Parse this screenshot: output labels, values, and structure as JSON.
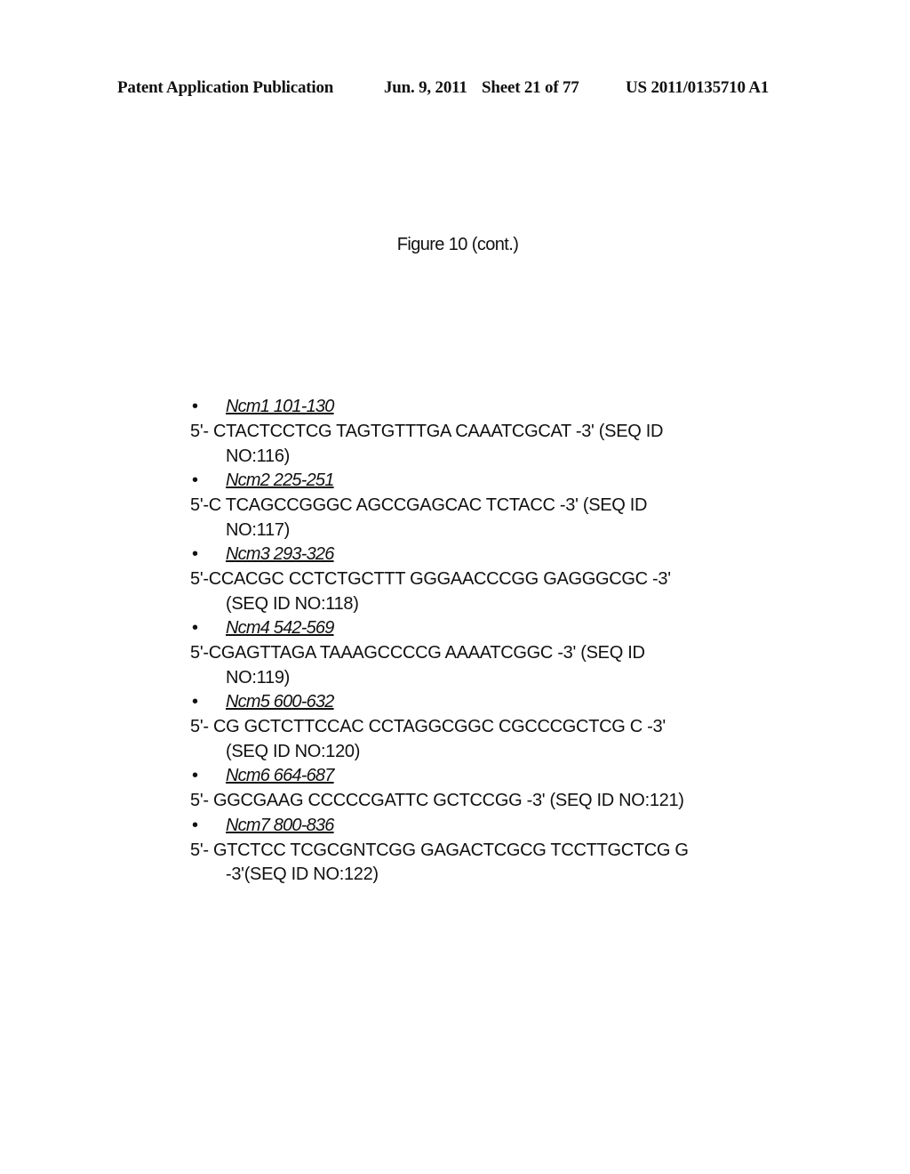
{
  "header": {
    "publication": "Patent Application Publication",
    "date": "Jun. 9, 2011",
    "sheet": "Sheet 21 of 77",
    "number": "US 2011/0135710 A1"
  },
  "figure": {
    "title": "Figure 10 (cont.)"
  },
  "bullet_glyph": "•",
  "entries": [
    {
      "label": "Ncm1 101-130",
      "line1": "5'- CTACTCCTCG TAGTGTTTGA CAAATCGCAT -3' (SEQ ID",
      "line2": "NO:116)"
    },
    {
      "label": "Ncm2 225-251",
      "line1": "5'-C TCAGCCGGGC AGCCGAGCAC TCTACC -3' (SEQ ID",
      "line2": "NO:117)"
    },
    {
      "label": "Ncm3 293-326",
      "line1": "5'-CCACGC CCTCTGCTTT GGGAACCCGG GAGGGCGC -3'",
      "line2": "(SEQ ID NO:118)"
    },
    {
      "label": "Ncm4 542-569",
      "line1": "5'-CGAGTTAGA TAAAGCCCCG AAAATCGGC -3' (SEQ ID",
      "line2": "NO:119)"
    },
    {
      "label": "Ncm5 600-632",
      "line1": "5'- CG GCTCTTCCAC CCTAGGCGGC CGCCCGCTCG C -3'",
      "line2": "(SEQ ID NO:120)"
    },
    {
      "label": "Ncm6 664-687",
      "line1": "5'- GGCGAAG CCCCCGATTC GCTCCGG -3' (SEQ ID NO:121)",
      "line2": null
    },
    {
      "label": "Ncm7 800-836",
      "line1": "5'- GTCTCC TCGCGNTCGG GAGACTCGCG TCCTTGCTCG G",
      "line2": "-3'(SEQ ID NO:122)"
    }
  ]
}
